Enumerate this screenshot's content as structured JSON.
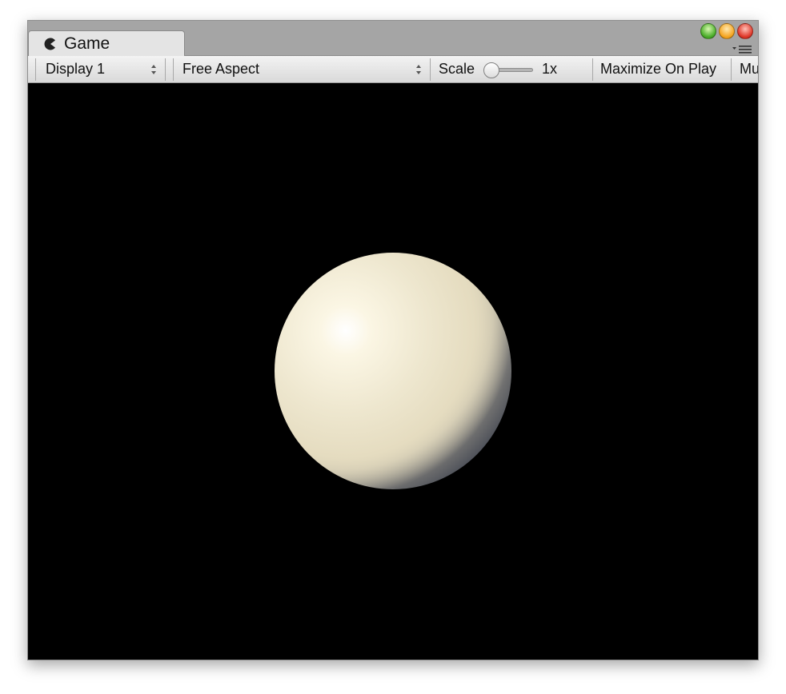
{
  "window": {
    "tab_title": "Game",
    "tab_icon": "pacman-icon",
    "controls": [
      "green-zoom",
      "yellow-minimize",
      "red-close"
    ],
    "menu_icon": "panel-menu-icon"
  },
  "toolbar": {
    "display_select": "Display 1",
    "aspect_select": "Free Aspect",
    "scale_label": "Scale",
    "scale_value": "1x",
    "scale_slider_fraction": 0,
    "maximize_button": "Maximize On Play",
    "mute_button": "Mu"
  },
  "viewport": {
    "background": "#000000",
    "object": "sphere",
    "sphere_color": "#eee7cf"
  }
}
